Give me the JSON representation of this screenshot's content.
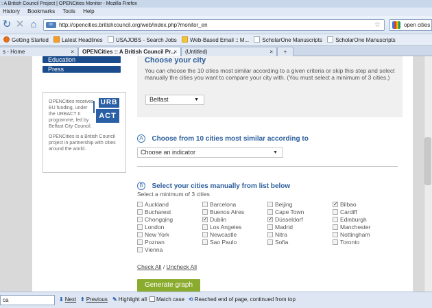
{
  "window": {
    "title": ": A British Council Project | OPENCities Monitor - Mozilla Firefox"
  },
  "menu": [
    "History",
    "Bookmarks",
    "Tools",
    "Help"
  ],
  "nav": {
    "url": "http://opencities.britishcouncil.org/web/index.php?monitor_en",
    "url_badge": "oc",
    "search_value": "open cities"
  },
  "bookmarks": [
    "Getting Started",
    "Latest Headlines",
    "USAJOBS - Search Jobs",
    "Web-Based Email :: M...",
    "ScholarOne Manuscripts",
    "ScholarOne Manuscripts"
  ],
  "tabs": [
    {
      "label": "s - Home",
      "active": false
    },
    {
      "label": "OPENCities :: A British Council Pr...",
      "active": true
    },
    {
      "label": "(Untitled)",
      "active": false
    }
  ],
  "tab_close": "×",
  "tab_new": "+",
  "sidebar": {
    "items": [
      "Education",
      "Press"
    ],
    "info_1": "OPENCities receives EU funding, under the URBACT II programme, led by Belfast City Council.",
    "info_2": "OPENCities is a British Council project in partnership with cities around the world.",
    "logo_top": "URB",
    "logo_bottom": "ACT"
  },
  "choose_city": {
    "heading": "Choose your city",
    "description": "You can choose the 10 cities most similar according to a given criteria or skip this step and select manually the cities you want to compare your city with. (You must select a minimum of 3 cities.)",
    "selected": "Belfast"
  },
  "section_a": {
    "marker": "A",
    "title": "Choose from 10 cities most similar according to",
    "indicator_placeholder": "Choose an indicator"
  },
  "section_b": {
    "marker": "B",
    "title": "Select your cities manually from list below",
    "subtext": "Select a minimum of 3 cities",
    "columns": [
      [
        {
          "name": "Auckland",
          "checked": false
        },
        {
          "name": "Bucharest",
          "checked": false
        },
        {
          "name": "Chongqing",
          "checked": false
        },
        {
          "name": "London",
          "checked": false
        },
        {
          "name": "New York",
          "checked": false
        },
        {
          "name": "Poznan",
          "checked": false
        },
        {
          "name": "Vienna",
          "checked": false
        }
      ],
      [
        {
          "name": "Barcelona",
          "checked": false
        },
        {
          "name": "Buenos Aires",
          "checked": false
        },
        {
          "name": "Dublin",
          "checked": true
        },
        {
          "name": "Los Angeles",
          "checked": false
        },
        {
          "name": "Newcastle",
          "checked": false
        },
        {
          "name": "Sao Paulo",
          "checked": false
        }
      ],
      [
        {
          "name": "Beijing",
          "checked": false
        },
        {
          "name": "Cape Town",
          "checked": false
        },
        {
          "name": "Düsseldorf",
          "checked": true
        },
        {
          "name": "Madrid",
          "checked": false
        },
        {
          "name": "Nitra",
          "checked": false
        },
        {
          "name": "Sofia",
          "checked": false
        }
      ],
      [
        {
          "name": "Bilbao",
          "checked": true
        },
        {
          "name": "Cardiff",
          "checked": false
        },
        {
          "name": "Edinburgh",
          "checked": false
        },
        {
          "name": "Manchester",
          "checked": false
        },
        {
          "name": "Nottingham",
          "checked": false
        },
        {
          "name": "Toronto",
          "checked": false
        }
      ]
    ]
  },
  "actions": {
    "check_all": "Check All",
    "separator": "/",
    "uncheck_all": "Uncheck All",
    "generate": "Generate graph"
  },
  "findbar": {
    "query": "ca",
    "next": "Next",
    "previous": "Previous",
    "highlight": "Highlight all",
    "match_case": "Match case",
    "status": "Reached end of page, continued from top"
  }
}
